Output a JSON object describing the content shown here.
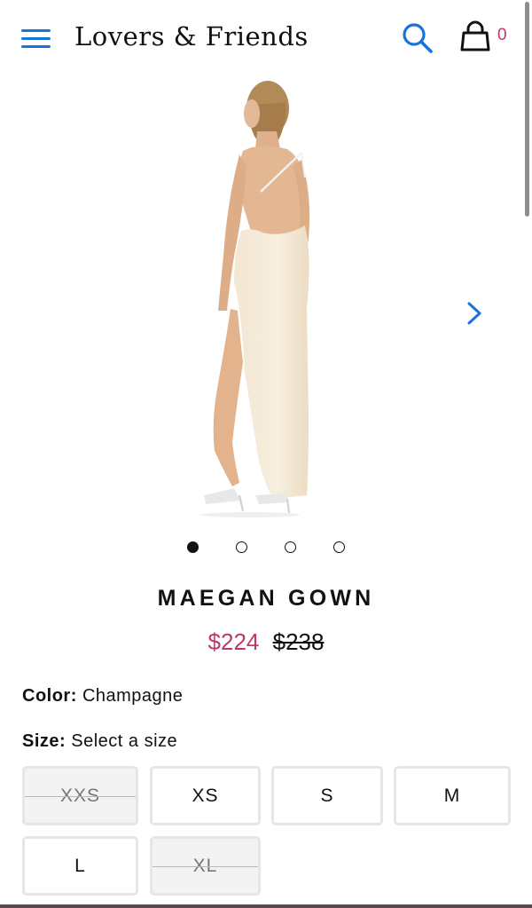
{
  "header": {
    "logo": "Lovers & Friends",
    "cart_count": "0",
    "menu_icon": "hamburger-menu-icon",
    "search_icon": "search-icon",
    "cart_icon": "shopping-bag-icon",
    "accent_color": "#1a73d9",
    "cart_count_color": "#c0356b"
  },
  "gallery": {
    "total_images": 4,
    "active_index": 0,
    "next_icon": "chevron-right-icon"
  },
  "product": {
    "name": "MAEGAN GOWN",
    "sale_price": "$224",
    "original_price": "$238",
    "sale_color": "#c0356b"
  },
  "color": {
    "label": "Color:",
    "value": "Champagne"
  },
  "size": {
    "label": "Size:",
    "placeholder": "Select a size",
    "options": [
      {
        "label": "XXS",
        "available": false
      },
      {
        "label": "XS",
        "available": true
      },
      {
        "label": "S",
        "available": true
      },
      {
        "label": "M",
        "available": true
      },
      {
        "label": "L",
        "available": true
      },
      {
        "label": "XL",
        "available": false
      }
    ]
  }
}
